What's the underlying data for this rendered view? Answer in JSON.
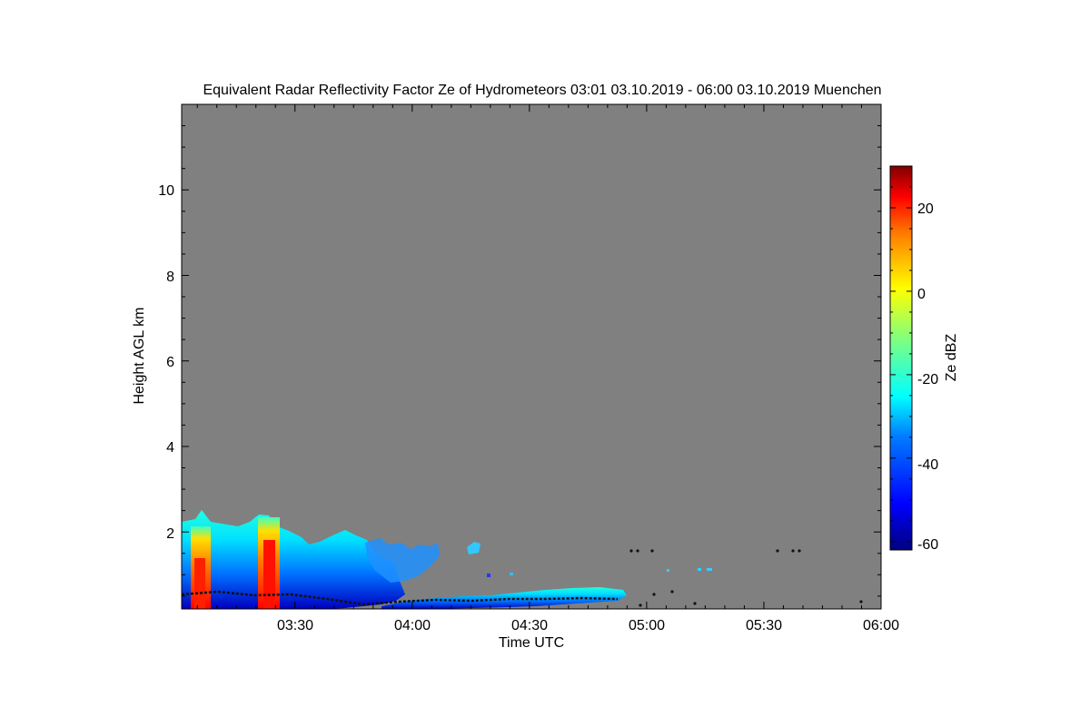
{
  "chart_data": {
    "type": "heatmap",
    "title": "Equivalent Radar Reflectivity Factor Ze of Hydrometeors   03:01 03.10.2019 - 06:00 03.10.2019 Muenchen",
    "xlabel": "Time UTC",
    "ylabel": "Height AGL km",
    "x_range": [
      "03:01",
      "06:00"
    ],
    "x_ticks": [
      "03:30",
      "04:00",
      "04:30",
      "05:00",
      "05:30",
      "06:00"
    ],
    "ylim": [
      0.2,
      12
    ],
    "y_ticks": [
      "2",
      "4",
      "6",
      "8",
      "10"
    ],
    "background_color": "#808080",
    "colorbar": {
      "label": "Ze dBZ",
      "range": [
        -62,
        30
      ],
      "ticks": [
        "-60",
        "-40",
        "-20",
        "0",
        "20"
      ],
      "colormap": "jet"
    },
    "echo_regions": [
      {
        "start": "03:01",
        "end": "03:35",
        "top_km": 2.4,
        "ze_max_dbz": 25
      },
      {
        "start": "03:35",
        "end": "03:50",
        "top_km": 1.9,
        "ze_max_dbz": -25
      },
      {
        "start": "03:50",
        "end": "04:10",
        "top_km": 1.8,
        "ze_max_dbz": -30
      },
      {
        "start": "04:10",
        "end": "04:20",
        "top_km": 1.8,
        "ze_max_dbz": -30
      },
      {
        "start": "04:20",
        "end": "04:55",
        "top_km": 0.7,
        "ze_max_dbz": -30
      }
    ],
    "cores": [
      {
        "time": "03:07",
        "ze_dbz": 25
      },
      {
        "time": "03:23",
        "ze_dbz": 27
      }
    ]
  }
}
